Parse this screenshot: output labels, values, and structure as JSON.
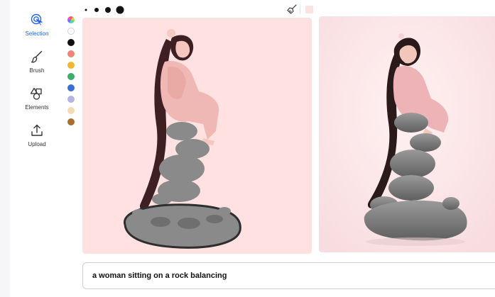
{
  "toolbar": {
    "tools": [
      {
        "label": "Selection",
        "icon": "selection-icon",
        "active": true
      },
      {
        "label": "Brush",
        "icon": "brush-icon",
        "active": false
      },
      {
        "label": "Elements",
        "icon": "elements-icon",
        "active": false
      },
      {
        "label": "Upload",
        "icon": "upload-icon",
        "active": false
      }
    ],
    "accent": "#2563eb"
  },
  "palette": {
    "swatches": [
      "color-wheel",
      "#ffffff",
      "#111111",
      "#ef8374",
      "#f2b632",
      "#3fae6a",
      "#3b6fd8",
      "#b7b3e6",
      "#f6d9b4",
      "#a8702c"
    ]
  },
  "brush_sizes": [
    "tiny",
    "small",
    "medium",
    "large"
  ],
  "top_tools": {
    "eraser_icon": "broom-icon",
    "current_color": "#fde2e2"
  },
  "canvas": {
    "background": "#ffe1e1"
  },
  "result": {
    "background": "#fde8ea"
  },
  "prompt": {
    "value": "a woman sitting on a rock balancing"
  }
}
